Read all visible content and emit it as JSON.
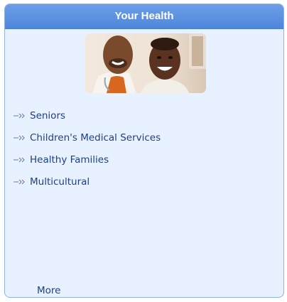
{
  "widget": {
    "title": "Your Health",
    "links": [
      {
        "label": "Seniors"
      },
      {
        "label": "Children's Medical Services"
      },
      {
        "label": "Healthy Families"
      },
      {
        "label": "Multicultural"
      }
    ],
    "more_label": "More"
  },
  "colors": {
    "header": "#5a8fe0",
    "panel_bg": "#e8f1ff",
    "link_text": "#1e3f86",
    "border": "#8fb3e8"
  },
  "icons": {
    "link_bullet": "double-chevron-arrow-icon"
  }
}
